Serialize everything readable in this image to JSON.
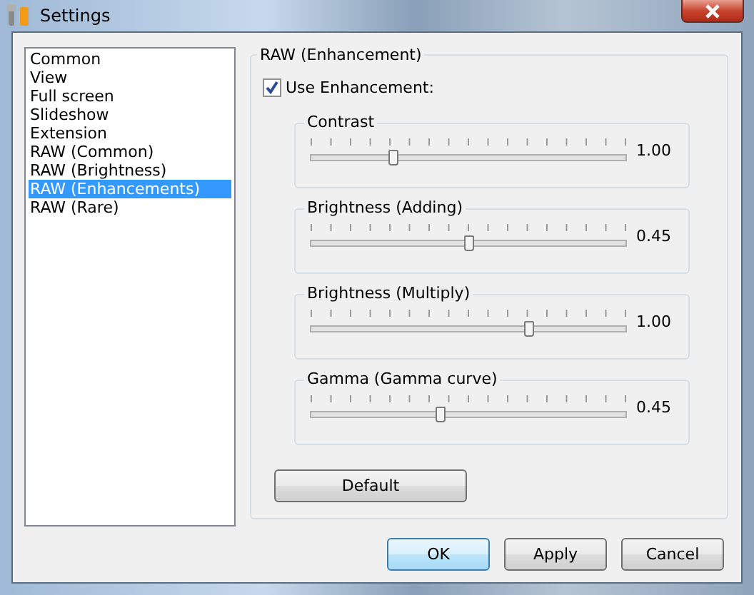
{
  "window": {
    "title": "Settings"
  },
  "sidebar": {
    "items": [
      {
        "label": "Common",
        "selected": false
      },
      {
        "label": "View",
        "selected": false
      },
      {
        "label": "Full screen",
        "selected": false
      },
      {
        "label": "Slideshow",
        "selected": false
      },
      {
        "label": "Extension",
        "selected": false
      },
      {
        "label": "RAW (Common)",
        "selected": false
      },
      {
        "label": "RAW (Brightness)",
        "selected": false
      },
      {
        "label": "RAW (Enhancements)",
        "selected": true
      },
      {
        "label": "RAW (Rare)",
        "selected": false
      }
    ]
  },
  "group": {
    "title": "RAW (Enhancement)",
    "use_enhancement": {
      "label": "Use Enhancement:",
      "checked": true
    },
    "sliders": [
      {
        "label": "Contrast",
        "level": 0.26,
        "reading": "1.00"
      },
      {
        "label": "Brightness (Adding)",
        "level": 0.5,
        "reading": "0.45"
      },
      {
        "label": "Brightness (Multiply)",
        "level": 0.69,
        "reading": "1.00"
      },
      {
        "label": "Gamma (Gamma curve)",
        "level": 0.41,
        "reading": "0.45"
      }
    ],
    "default_button": "Default"
  },
  "buttons": [
    {
      "label": "OK",
      "kind": "default"
    },
    {
      "label": "Apply",
      "kind": "normal"
    },
    {
      "label": "Cancel",
      "kind": "normal"
    }
  ]
}
